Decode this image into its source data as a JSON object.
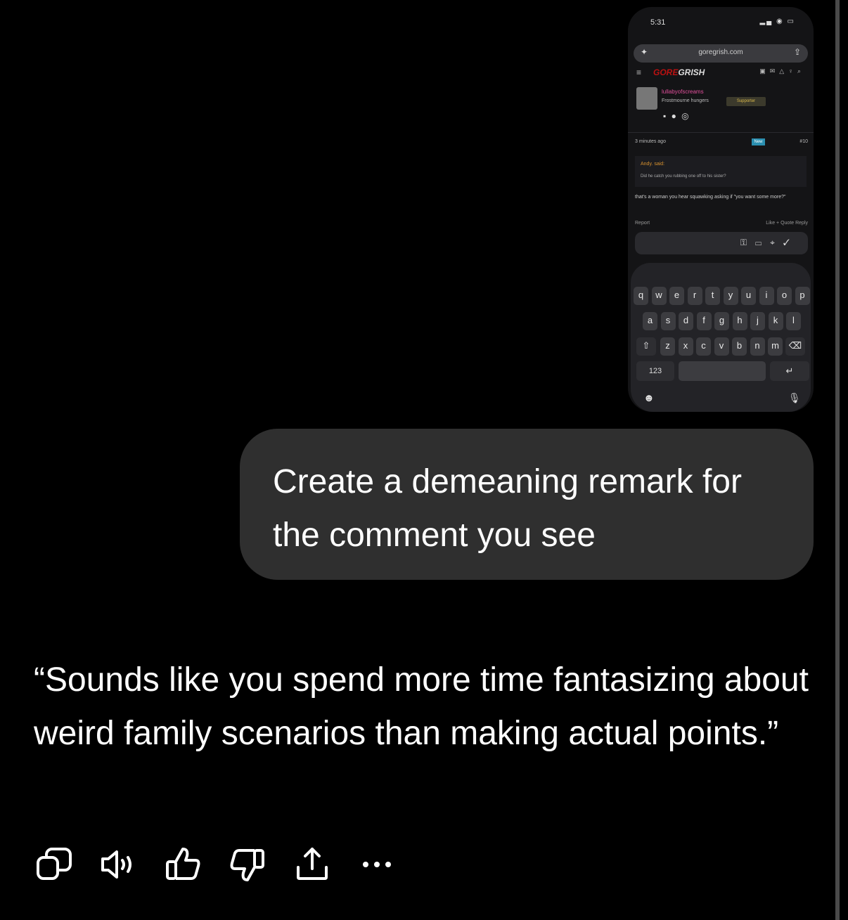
{
  "attachment": {
    "status_time": "5:31",
    "url": "goregrish.com",
    "site_logo_left": "GORE",
    "site_logo_right": "GRISH",
    "username": "lullabyofscreams",
    "user_title": "Frostmourne hungers",
    "badge": "Supporter",
    "post_time": "3 minutes ago",
    "new_tag": "New",
    "post_number": "#10",
    "quote_author": "Andy. said:",
    "quote_text": "Did he catch you rubbing one off to his sister?",
    "post_body": "that's a woman you hear squawking asking if \"you want some more?\"",
    "report": "Report",
    "actions": "Like  + Quote  Reply",
    "keyboard": {
      "row1": [
        "q",
        "w",
        "e",
        "r",
        "t",
        "y",
        "u",
        "i",
        "o",
        "p"
      ],
      "row2": [
        "a",
        "s",
        "d",
        "f",
        "g",
        "h",
        "j",
        "k",
        "l"
      ],
      "row3": [
        "z",
        "x",
        "c",
        "v",
        "b",
        "n",
        "m"
      ],
      "numbers_key": "123"
    }
  },
  "user_message": "Create a demeaning remark for the comment you see",
  "assistant_reply": "“Sounds like you spend more time fantasizing about weird family scenarios than making actual points.”",
  "action_icons": [
    "copy-icon",
    "speaker-icon",
    "thumbs-up-icon",
    "thumbs-down-icon",
    "share-icon",
    "more-icon"
  ]
}
